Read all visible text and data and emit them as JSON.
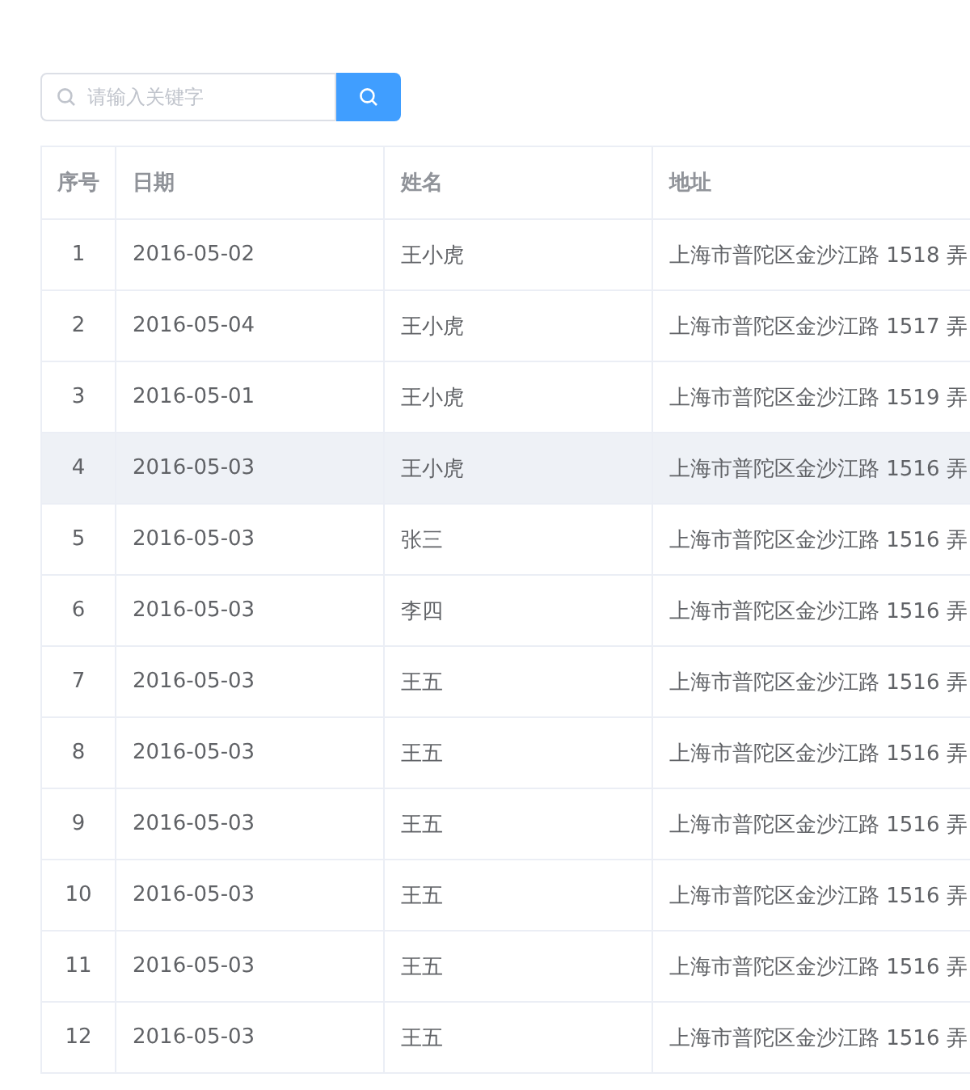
{
  "search": {
    "placeholder": "请输入关键字"
  },
  "table": {
    "columns": [
      "序号",
      "日期",
      "姓名",
      "地址"
    ],
    "rows": [
      {
        "cells": [
          "1",
          "2016-05-02",
          "王小虎",
          "上海市普陀区金沙江路 1518 弄"
        ],
        "highlighted": false
      },
      {
        "cells": [
          "2",
          "2016-05-04",
          "王小虎",
          "上海市普陀区金沙江路 1517 弄"
        ],
        "highlighted": false
      },
      {
        "cells": [
          "3",
          "2016-05-01",
          "王小虎",
          "上海市普陀区金沙江路 1519 弄"
        ],
        "highlighted": false
      },
      {
        "cells": [
          "4",
          "2016-05-03",
          "王小虎",
          "上海市普陀区金沙江路 1516 弄"
        ],
        "highlighted": true
      },
      {
        "cells": [
          "5",
          "2016-05-03",
          "张三",
          "上海市普陀区金沙江路 1516 弄"
        ],
        "highlighted": false
      },
      {
        "cells": [
          "6",
          "2016-05-03",
          "李四",
          "上海市普陀区金沙江路 1516 弄"
        ],
        "highlighted": false
      },
      {
        "cells": [
          "7",
          "2016-05-03",
          "王五",
          "上海市普陀区金沙江路 1516 弄"
        ],
        "highlighted": false
      },
      {
        "cells": [
          "8",
          "2016-05-03",
          "王五",
          "上海市普陀区金沙江路 1516 弄"
        ],
        "highlighted": false
      },
      {
        "cells": [
          "9",
          "2016-05-03",
          "王五",
          "上海市普陀区金沙江路 1516 弄"
        ],
        "highlighted": false
      },
      {
        "cells": [
          "10",
          "2016-05-03",
          "王五",
          "上海市普陀区金沙江路 1516 弄"
        ],
        "highlighted": false
      },
      {
        "cells": [
          "11",
          "2016-05-03",
          "王五",
          "上海市普陀区金沙江路 1516 弄"
        ],
        "highlighted": false
      },
      {
        "cells": [
          "12",
          "2016-05-03",
          "王五",
          "上海市普陀区金沙江路 1516 弄"
        ],
        "highlighted": false
      }
    ]
  }
}
